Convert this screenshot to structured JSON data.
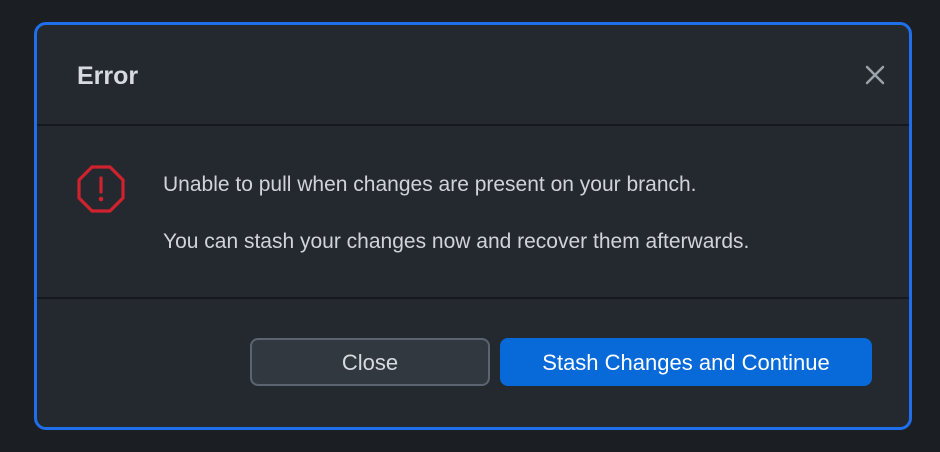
{
  "dialog": {
    "title": "Error",
    "close_icon": "close-x-icon",
    "error_icon": "octagon-alert-icon",
    "messages": [
      "Unable to pull when changes are present on your branch.",
      "You can stash your changes now and recover them afterwards."
    ],
    "buttons": {
      "close_label": "Close",
      "stash_label": "Stash Changes and Continue"
    }
  },
  "colors": {
    "accent": "#1f6feb",
    "primary_button": "#0869d9",
    "error": "#cf222e",
    "background": "#24292f"
  }
}
